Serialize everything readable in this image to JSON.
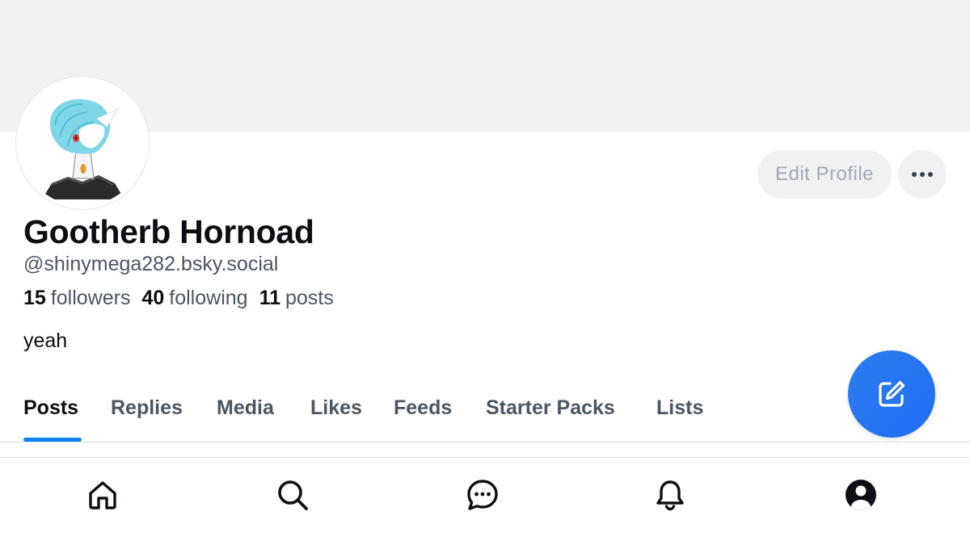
{
  "profile": {
    "display_name": "Gootherb Hornoad",
    "handle": "@shinymega282.bsky.social",
    "bio": "yeah",
    "stats": {
      "followers_count": "15",
      "followers_label": "followers",
      "following_count": "40",
      "following_label": "following",
      "posts_count": "11",
      "posts_label": "posts"
    }
  },
  "actions": {
    "edit_profile_label": "Edit Profile",
    "more_icon": "more-horizontal-icon"
  },
  "tabs": [
    {
      "label": "Posts",
      "active": true
    },
    {
      "label": "Replies",
      "active": false
    },
    {
      "label": "Media",
      "active": false
    },
    {
      "label": "Likes",
      "active": false
    },
    {
      "label": "Feeds",
      "active": false
    },
    {
      "label": "Starter Packs",
      "active": false
    },
    {
      "label": "Lists",
      "active": false
    }
  ],
  "fab": {
    "icon": "compose-icon"
  },
  "bottom_nav": [
    {
      "icon": "home-icon"
    },
    {
      "icon": "search-icon"
    },
    {
      "icon": "chat-icon"
    },
    {
      "icon": "bell-icon"
    },
    {
      "icon": "profile-icon"
    }
  ],
  "colors": {
    "accent": "#1083fe",
    "banner": "#f1f2f4",
    "text_primary": "#0b0f14",
    "text_secondary": "#4c5663"
  }
}
